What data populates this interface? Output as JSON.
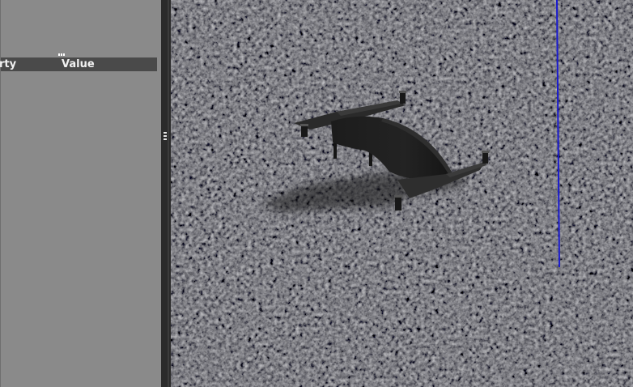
{
  "properties_panel": {
    "columns": {
      "property": "rty",
      "value": "Value"
    }
  },
  "viewport": {
    "ground_texture": "asphalt-gravel",
    "model": "tailsitter-drone",
    "axis_line_color": "#1a1ad0"
  },
  "colors": {
    "panel_bg": "#8a8a8a",
    "header_bg": "#4a4a4a",
    "splitter_bg": "#2b2b2b",
    "ground_base": "#3d3d3f"
  }
}
